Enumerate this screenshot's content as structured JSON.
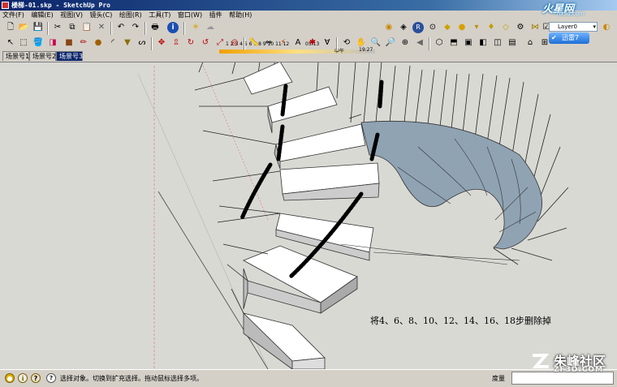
{
  "window": {
    "title": "楼梯-01.skp - SketchUp Pro"
  },
  "watermark_top": {
    "line1": "火星网",
    "line2": "hxsd.com"
  },
  "menu": [
    "文件(F)",
    "编辑(E)",
    "视图(V)",
    "镜头(C)",
    "绘图(R)",
    "工具(T)",
    "窗口(W)",
    "插件",
    "帮助(H)"
  ],
  "timebar": {
    "numbers": "1 2 3 4 5 6 7 8 9 10 11 12",
    "time_left": "05:13",
    "noon": "中午",
    "time_right": "19:27"
  },
  "layer": {
    "current": "Layer0"
  },
  "xunlei": {
    "label": "迅雷7"
  },
  "scene_tabs": [
    {
      "label": "场景号1",
      "active": false
    },
    {
      "label": "场景号2",
      "active": false
    },
    {
      "label": "场景号3",
      "active": true
    }
  ],
  "annotation": "将4、6、8、10、12、14、16、18步删除掉",
  "status": {
    "hint": "选择对象。切换到扩充选择。拖动鼠标选择多项。",
    "measure_label": "度量"
  },
  "watermark_bottom": {
    "line1": "朱峰社区",
    "line2": "ZF3D.COM"
  },
  "colors": {
    "title_blue": "#0a246a",
    "viewport_bg": "#d9d9d4",
    "stair_face": "#ffffff",
    "stair_dark": "#7f93a3",
    "arc": "#000000"
  }
}
